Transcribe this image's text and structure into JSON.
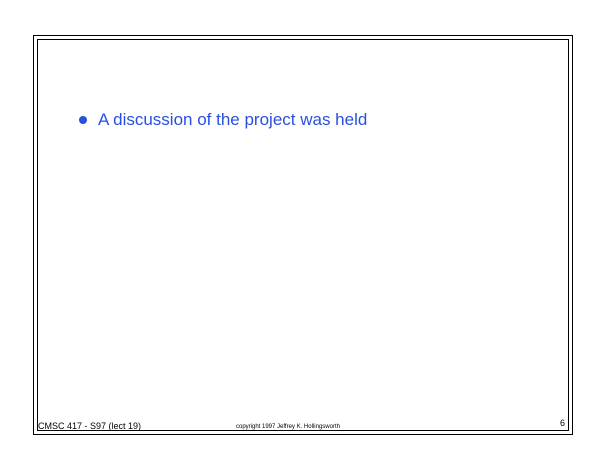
{
  "slide": {
    "bullets": [
      {
        "text": "A discussion of the project was held"
      }
    ],
    "accent_color": "#2850e0"
  },
  "footer": {
    "course": "CMSC 417 - S97  (lect 19)",
    "copyright": "copyright 1997  Jeffrey K. Hollingsworth",
    "page_number": "6"
  }
}
